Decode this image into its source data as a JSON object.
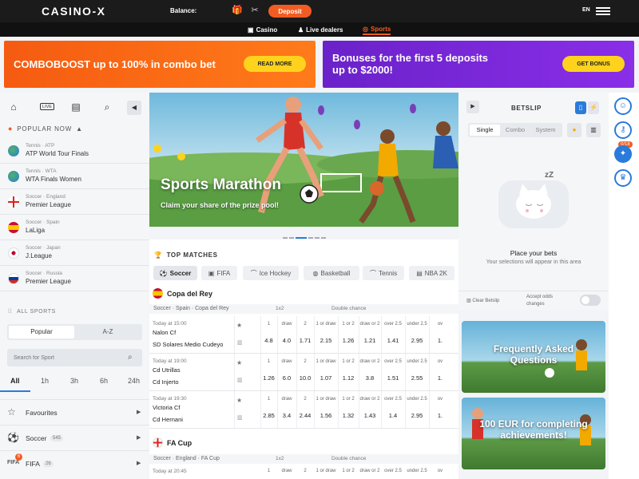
{
  "header": {
    "logo": "CASINO-X",
    "balance_label": "Balance:",
    "deposit_label": "Deposit",
    "lang": "EN"
  },
  "nav": {
    "casino": "Casino",
    "live": "Live dealers",
    "sports": "Sports"
  },
  "banners": [
    {
      "text": "COMBOBOOST up to 100% in combo bet",
      "button": "READ MORE"
    },
    {
      "text_line1": "Bonuses for the first 5 deposits",
      "text_line2": "up to $2000!",
      "button": "GET BONUS"
    }
  ],
  "sidebar": {
    "live_tab": "LIVE",
    "popular_label": "POPULAR NOW",
    "popular": [
      {
        "sub": "Tennis · ATP",
        "name": "ATP World Tour Finals"
      },
      {
        "sub": "Tennis · WTA",
        "name": "WTA Finals Women"
      },
      {
        "sub": "Soccer · England",
        "name": "Premier League"
      },
      {
        "sub": "Soccer · Spain",
        "name": "LaLiga"
      },
      {
        "sub": "Soccer · Japan",
        "name": "J.League"
      },
      {
        "sub": "Soccer · Russia",
        "name": "Premier League"
      }
    ],
    "all_sports_label": "ALL SPORTS",
    "seg_popular": "Popular",
    "seg_az": "A-Z",
    "search_placeholder": "Search for Sport",
    "time_tabs": [
      "All",
      "1h",
      "3h",
      "6h",
      "24h"
    ],
    "sports": [
      {
        "name": "Favourites",
        "count": ""
      },
      {
        "name": "Soccer",
        "count": "545"
      },
      {
        "name": "FIFA",
        "count": "26"
      }
    ],
    "fifa_badge": "6"
  },
  "hero": {
    "title": "Sports Marathon",
    "subtitle": "Claim your share of the prize pool!"
  },
  "top_matches": {
    "label": "TOP MATCHES",
    "sports": [
      "Soccer",
      "FIFA",
      "Ice Hockey",
      "Basketball",
      "Tennis",
      "NBA 2K"
    ],
    "odds_groups": {
      "g1": "1x2",
      "g2": "Double chance"
    },
    "odds_headers": [
      "1",
      "draw",
      "2",
      "1 or draw",
      "1 or 2",
      "draw or 2",
      "over 2.5",
      "under 2.5",
      "ov"
    ],
    "leagues": [
      {
        "name": "Copa del Rey",
        "path": "Soccer · Spain · Copa del Rey",
        "matches": [
          {
            "time": "Today at 15:00",
            "t1": "Nalon Cf",
            "t2": "SD Solares Medio Cudeyo",
            "odds": [
              "4.8",
              "4.0",
              "1.71",
              "2.15",
              "1.26",
              "1.21",
              "1.41",
              "2.95",
              "1."
            ]
          },
          {
            "time": "Today at 19:00",
            "t1": "Cd Utrillas",
            "t2": "Cd Injerto",
            "odds": [
              "1.26",
              "6.0",
              "10.0",
              "1.07",
              "1.12",
              "3.8",
              "1.51",
              "2.55",
              "1."
            ]
          },
          {
            "time": "Today at 19:30",
            "t1": "Victoria Cf",
            "t2": "Cd Hernani",
            "odds": [
              "2.85",
              "3.4",
              "2.44",
              "1.56",
              "1.32",
              "1.43",
              "1.4",
              "2.95",
              "1."
            ]
          }
        ]
      },
      {
        "name": "FA Cup",
        "path": "Soccer · England · FA Cup",
        "next_time": "Today at 20:45",
        "next_headers": [
          "1",
          "draw",
          "2",
          "1 or draw",
          "1 or 2",
          "draw or 2",
          "over 2.5",
          "under 2.5",
          "ov"
        ]
      }
    ]
  },
  "betslip": {
    "title": "BETSLIP",
    "count_badge": "0/18",
    "tabs": [
      "Single",
      "Combo",
      "System"
    ],
    "place_bets": "Place your bets",
    "selections": "Your selections will appear in this area",
    "clear": "Clear Betslip",
    "accept_line1": "Accept odds",
    "accept_line2": "changes"
  },
  "promos": [
    {
      "line1": "Frequently Asked",
      "line2": "Questions"
    },
    {
      "line1": "100 EUR for completing",
      "line2": "achievements!"
    }
  ]
}
